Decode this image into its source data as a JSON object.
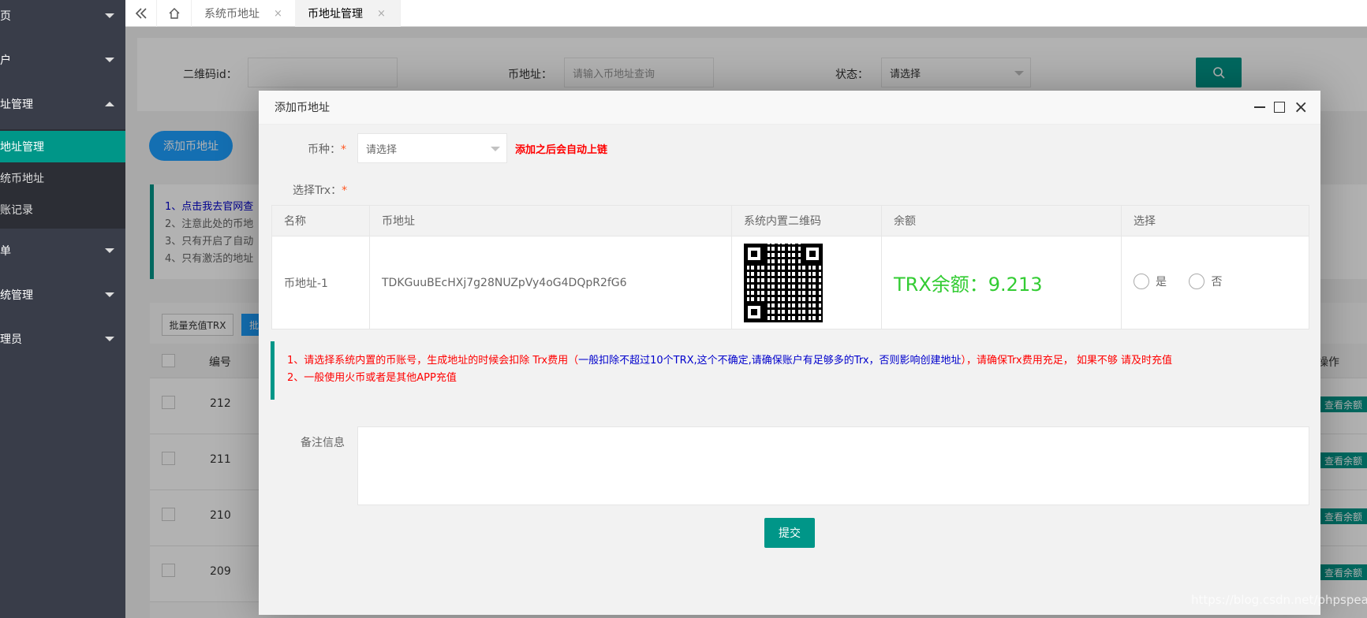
{
  "sidebar": {
    "items": [
      {
        "label": "页"
      },
      {
        "label": "户"
      },
      {
        "label": "址管理"
      },
      {
        "label": "单"
      },
      {
        "label": "统管理"
      },
      {
        "label": "理员"
      }
    ],
    "sub_items": [
      {
        "label": "地址管理"
      },
      {
        "label": "统币地址"
      },
      {
        "label": "账记录"
      }
    ]
  },
  "tabs": {
    "items": [
      {
        "label": "系统币地址",
        "close": "×"
      },
      {
        "label": "币地址管理",
        "close": "×"
      }
    ]
  },
  "search": {
    "qr_id_label": "二维码id：",
    "address_label": "币地址：",
    "address_placeholder": "请输入币地址查询",
    "status_label": "状态：",
    "status_value": "请选择"
  },
  "page": {
    "add_button": "添加币地址",
    "notes": [
      "1、点击我去官网查",
      "2、注意此处的币地",
      "3、只有开启了自动",
      "4、只有激活的地址"
    ],
    "batch_button": "批量充值TRX",
    "batch_button2": "批",
    "col_id": "编号",
    "col_action": "操作",
    "rows": [
      {
        "id": "212",
        "action": "查看余额"
      },
      {
        "id": "211",
        "action": "查看余额"
      },
      {
        "id": "210",
        "action": "查看余额"
      },
      {
        "id": "209",
        "action": "查看余额"
      }
    ]
  },
  "modal": {
    "title": "添加币地址",
    "coin_label": "币种：",
    "coin_select": "请选择",
    "auto_chain_note": "添加之后会自动上链",
    "trx_label": "选择Trx：",
    "table": {
      "headers": [
        "名称",
        "币地址",
        "系统内置二维码",
        "余额",
        "选择"
      ],
      "row": {
        "name": "币地址-1",
        "address": "TDKGuuBEcHXj7g28NUZpVy4oG4DQpR2fG6",
        "balance": "TRX余额：9.213",
        "opt_yes": "是",
        "opt_no": "否"
      }
    },
    "tip1_red": "1、请选择系统内置的币账号，生成地址的时候会扣除 Trx费用（",
    "tip1_blue": "一般扣除不超过10个TRX,这个不确定,请确保账户有足够多的Trx，否则影响创建地址",
    "tip1_red2": "），请确保Trx费用充足， 如果不够 请及时充值",
    "tip2": "2、一般使用火币或者是其他APP充值",
    "remark_label": "备注信息",
    "submit": "提交"
  },
  "watermark": "https://blog.csdn.net/phpspeak"
}
